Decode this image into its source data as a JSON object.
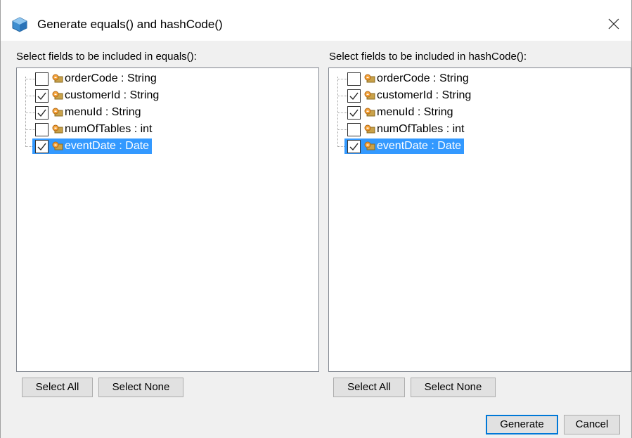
{
  "window": {
    "title": "Generate equals() and hashCode()",
    "close_symbol": "✕"
  },
  "equals_panel": {
    "label": "Select fields to be included in equals():",
    "fields": [
      {
        "label": "orderCode : String",
        "checked": false,
        "selected": false
      },
      {
        "label": "customerId : String",
        "checked": true,
        "selected": false
      },
      {
        "label": "menuId : String",
        "checked": true,
        "selected": false
      },
      {
        "label": "numOfTables : int",
        "checked": false,
        "selected": false
      },
      {
        "label": "eventDate : Date",
        "checked": true,
        "selected": true
      }
    ],
    "select_all_label": "Select All",
    "select_none_label": "Select None"
  },
  "hashcode_panel": {
    "label": "Select fields to be included in hashCode():",
    "fields": [
      {
        "label": "orderCode : String",
        "checked": false,
        "selected": false
      },
      {
        "label": "customerId : String",
        "checked": true,
        "selected": false
      },
      {
        "label": "menuId : String",
        "checked": true,
        "selected": false
      },
      {
        "label": "numOfTables : int",
        "checked": false,
        "selected": false
      },
      {
        "label": "eventDate : Date",
        "checked": true,
        "selected": true
      }
    ],
    "select_all_label": "Select All",
    "select_none_label": "Select None"
  },
  "footer": {
    "generate_label": "Generate",
    "cancel_label": "Cancel"
  },
  "colors": {
    "selection": "#3399ff",
    "dialog_bg": "#f0f0f0",
    "default_button_border": "#0078d7"
  },
  "icons": {
    "title": "netbeans-cube-icon",
    "field": "field-icon",
    "close": "close-icon",
    "check": "checkmark-icon"
  }
}
